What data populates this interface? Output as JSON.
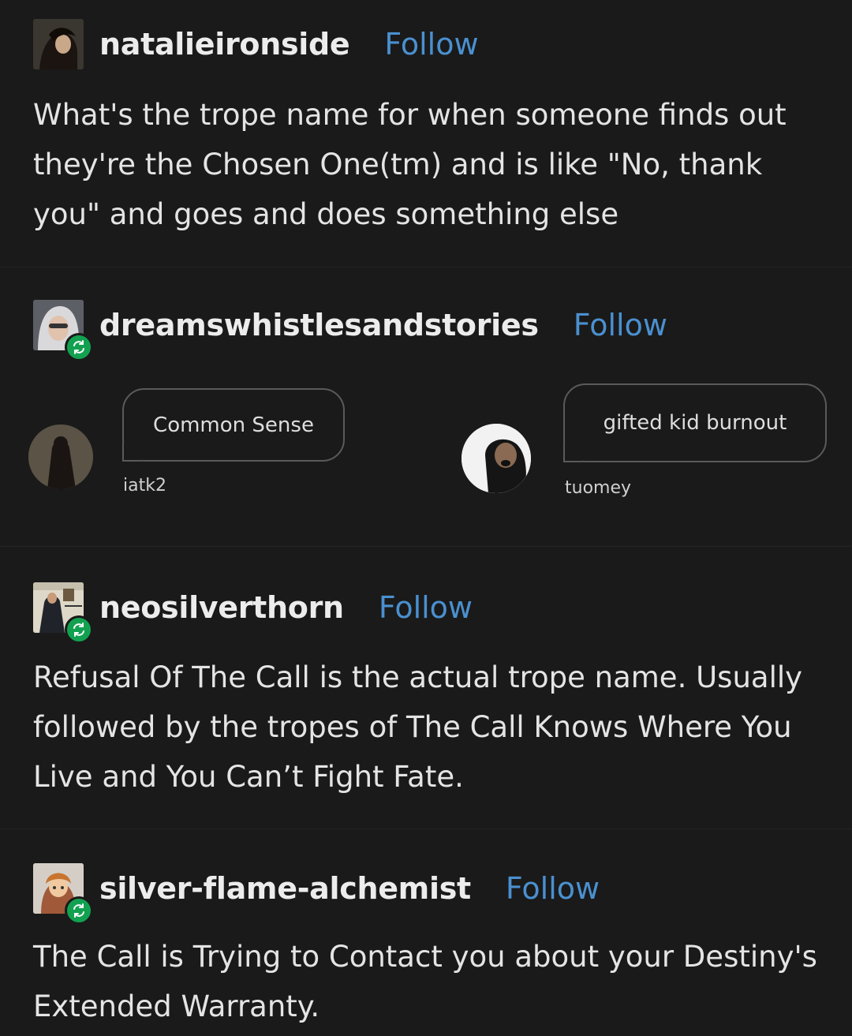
{
  "posts": [
    {
      "username": "natalieironside",
      "follow_label": "Follow",
      "text": "What's the trope name for when someone finds out they're the Chosen One(tm) and is like \"No, thank you\" and goes and does something else"
    },
    {
      "username": "dreamswhistlesandstories",
      "follow_label": "Follow",
      "comments": [
        {
          "bubble": "Common Sense",
          "user": "iatk2"
        },
        {
          "bubble": "gifted kid burnout",
          "user": "tuomey"
        }
      ]
    },
    {
      "username": "neosilverthorn",
      "follow_label": "Follow",
      "text": "Refusal Of The Call is the actual trope name.  Usually followed by the tropes of The Call Knows Where You Live and You Can’t Fight Fate."
    },
    {
      "username": "silver-flame-alchemist",
      "follow_label": "Follow",
      "text": "The Call is Trying to Contact you about your Destiny's Extended Warranty."
    }
  ],
  "colors": {
    "background": "#1a1a1a",
    "follow": "#4a90d0",
    "reblog_badge": "#12a150"
  }
}
